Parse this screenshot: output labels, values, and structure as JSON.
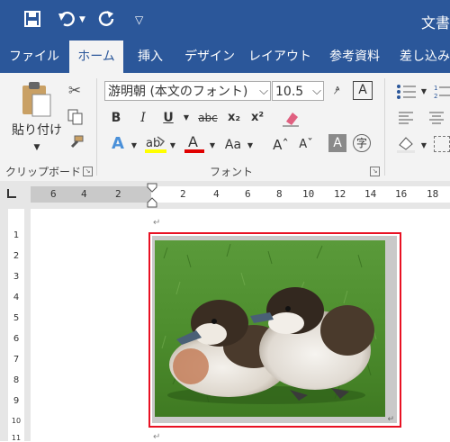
{
  "title_bar": {
    "doc_title": "文書"
  },
  "tabs": [
    {
      "label": "ファイル"
    },
    {
      "label": "ホーム"
    },
    {
      "label": "挿入"
    },
    {
      "label": "デザイン"
    },
    {
      "label": "レイアウト"
    },
    {
      "label": "参考資料"
    },
    {
      "label": "差し込み"
    }
  ],
  "clipboard": {
    "paste_label": "貼り付け",
    "group_label": "クリップボード"
  },
  "font": {
    "font_name": "游明朝 (本文のフォント)",
    "font_size": "10.5",
    "group_label": "フォント"
  },
  "ruler": {
    "h_labels": [
      "6",
      "4",
      "2",
      "2",
      "4",
      "6",
      "8",
      "10",
      "12",
      "14",
      "16",
      "18"
    ],
    "v_labels": [
      "1",
      "2",
      "3",
      "4",
      "5",
      "6",
      "7",
      "8",
      "9",
      "10",
      "11"
    ]
  },
  "colors": {
    "accent": "#2b579a",
    "highlight": "#ffff00",
    "font_color": "#e00000",
    "selection_border": "#e81123"
  },
  "image": {
    "description": "two ducklings on grass"
  }
}
